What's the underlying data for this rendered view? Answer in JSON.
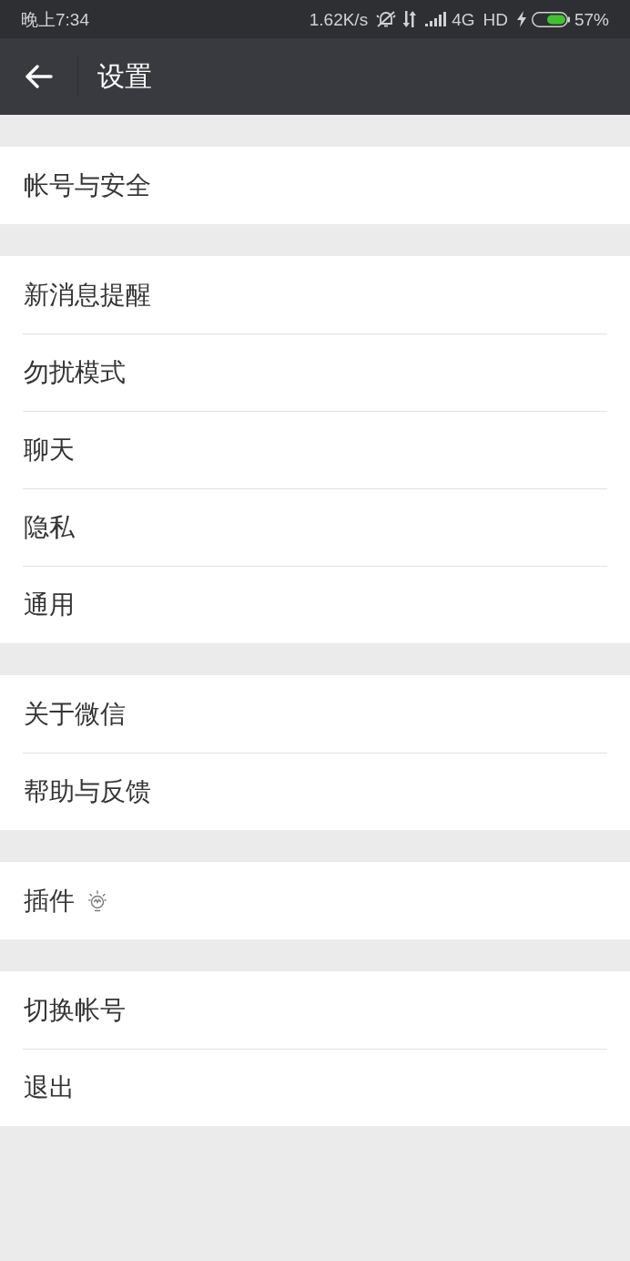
{
  "status_bar": {
    "time": "晚上7:34",
    "network_speed": "1.62K/s",
    "network_type": "4G",
    "hd_label": "HD",
    "battery_percent": "57%"
  },
  "header": {
    "title": "设置"
  },
  "groups": [
    [
      {
        "label": "帐号与安全",
        "kind": "plain"
      }
    ],
    [
      {
        "label": "新消息提醒",
        "kind": "plain"
      },
      {
        "label": "勿扰模式",
        "kind": "plain"
      },
      {
        "label": "聊天",
        "kind": "plain"
      },
      {
        "label": "隐私",
        "kind": "plain"
      },
      {
        "label": "通用",
        "kind": "plain"
      }
    ],
    [
      {
        "label": "关于微信",
        "kind": "plain"
      },
      {
        "label": "帮助与反馈",
        "kind": "plain"
      }
    ],
    [
      {
        "label": "插件",
        "kind": "bulb"
      }
    ],
    [
      {
        "label": "切换帐号",
        "kind": "plain"
      },
      {
        "label": "退出",
        "kind": "plain"
      }
    ]
  ]
}
